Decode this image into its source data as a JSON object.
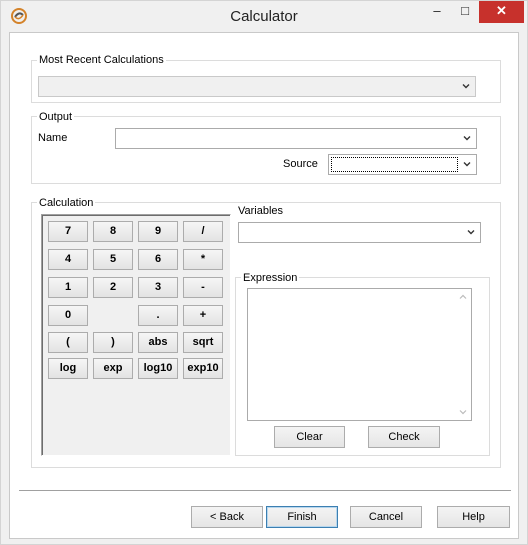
{
  "window": {
    "title": "Calculator",
    "controls": {
      "minimize": "–",
      "maximize": "□",
      "close": "✕"
    }
  },
  "recent": {
    "label": "Most Recent Calculations",
    "value": ""
  },
  "output": {
    "label": "Output",
    "name_label": "Name",
    "name_value": "",
    "source_label": "Source",
    "source_value": ""
  },
  "calculation": {
    "label": "Calculation",
    "buttons": {
      "b7": "7",
      "b8": "8",
      "b9": "9",
      "div": "/",
      "b4": "4",
      "b5": "5",
      "b6": "6",
      "mul": "*",
      "b1": "1",
      "b2": "2",
      "b3": "3",
      "sub": "-",
      "b0": "0",
      "dot": ".",
      "add": "+",
      "lparen": "(",
      "rparen": ")",
      "abs": "abs",
      "sqrt": "sqrt",
      "log": "log",
      "exp": "exp",
      "log10": "log10",
      "exp10": "exp10"
    }
  },
  "variables": {
    "label": "Variables",
    "value": ""
  },
  "expression": {
    "label": "Expression",
    "value": "",
    "clear_label": "Clear",
    "check_label": "Check"
  },
  "footer": {
    "back_label": "< Back",
    "finish_label": "Finish",
    "cancel_label": "Cancel",
    "help_label": "Help"
  },
  "icons": {
    "app": "calculator-app-icon",
    "dropdown": "chevron-down-icon",
    "scroll_up": "scroll-up-icon",
    "scroll_down": "scroll-down-icon"
  },
  "colors": {
    "close_button": "#c7312c",
    "default_button_border": "#3c7fb1",
    "app_icon": "#d4832a"
  }
}
